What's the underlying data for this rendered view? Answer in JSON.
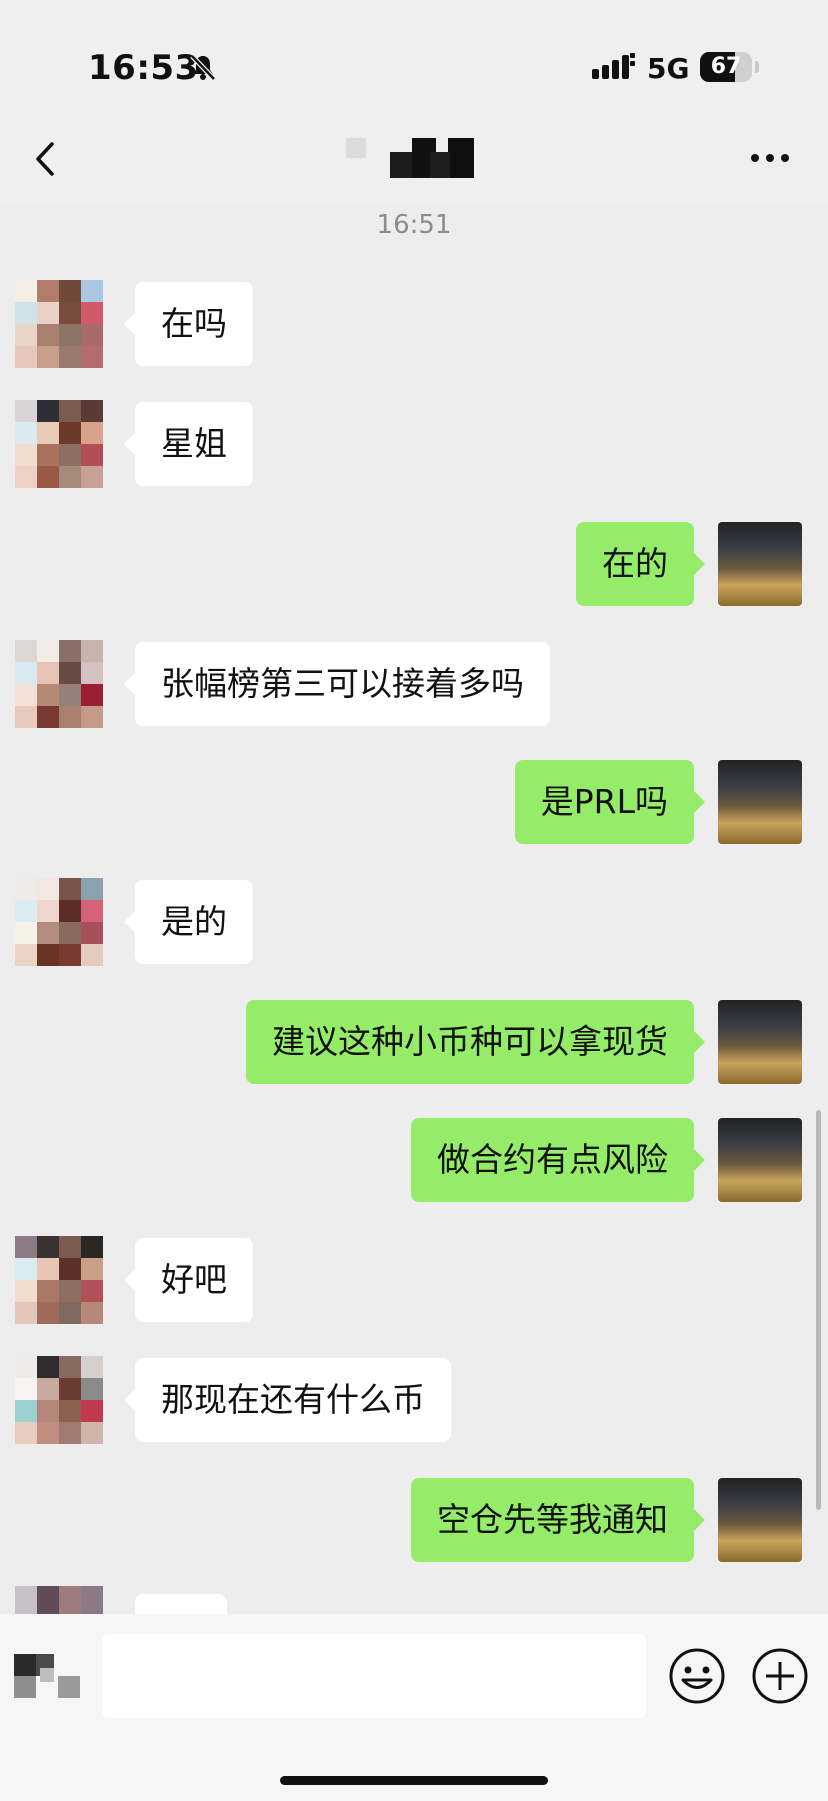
{
  "status_bar": {
    "time": "16:53",
    "network": "5G",
    "battery": "67",
    "battery_level": 0.67
  },
  "nav": {
    "title": ""
  },
  "chat": {
    "timestamp": "16:51",
    "messages": [
      {
        "side": "in",
        "text": "在吗"
      },
      {
        "side": "in",
        "text": "星姐"
      },
      {
        "side": "out",
        "text": "在的"
      },
      {
        "side": "in",
        "text": "张幅榜第三可以接着多吗"
      },
      {
        "side": "out",
        "text": "是PRL吗"
      },
      {
        "side": "in",
        "text": "是的"
      },
      {
        "side": "out",
        "text": "建议这种小币种可以拿现货"
      },
      {
        "side": "out",
        "text": "做合约有点风险"
      },
      {
        "side": "in",
        "text": "好吧"
      },
      {
        "side": "in",
        "text": "那现在还有什么币"
      },
      {
        "side": "out",
        "text": "空仓先等我通知"
      }
    ]
  },
  "input_bar": {
    "value": "",
    "placeholder": ""
  },
  "colors": {
    "background": "#ededed",
    "bubble_out": "#95ec69",
    "bubble_in": "#ffffff",
    "timestamp": "#8c8c8c"
  },
  "icons": {
    "back": "chevron-left-icon",
    "more": "more-icon",
    "mute": "bell-slash-icon",
    "signal": "signal-icon",
    "voice": "voice-icon",
    "emoji": "emoji-icon",
    "plus": "plus-icon"
  }
}
